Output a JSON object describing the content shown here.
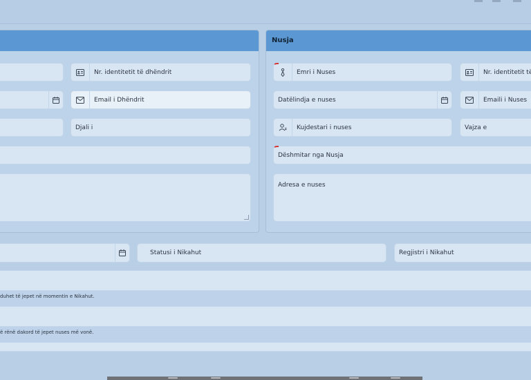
{
  "groom_panel": {
    "fields": {
      "id_number": "Nr. identitetit të dhëndrit",
      "email": "Email i Dhëndrit",
      "son_of": "Djali i"
    }
  },
  "bride_panel": {
    "title": "Nusja",
    "fields": {
      "name": "Emri i Nuses",
      "id_number": "Nr. identitetit të nus",
      "birthdate": "Datëlindja e nuses",
      "email": "Emaili i Nuses",
      "guardian": "Kujdestari i nuses",
      "daughter_of": "Vajza e",
      "witness": "Dëshmitar nga Nusja",
      "address": "Adresa e nuses"
    }
  },
  "nikah": {
    "status": "Statusi i Nikahut",
    "registry": "Regjistri i Nikahut"
  },
  "notes": {
    "mahr_now": "duhet të jepet në momentin e Nikahut.",
    "mahr_later": "ë rënë dakord të jepet nuses më vonë."
  },
  "icons": [
    "id-card-icon",
    "email-icon",
    "calendar-icon",
    "person-tie-icon",
    "guardian-icon"
  ]
}
